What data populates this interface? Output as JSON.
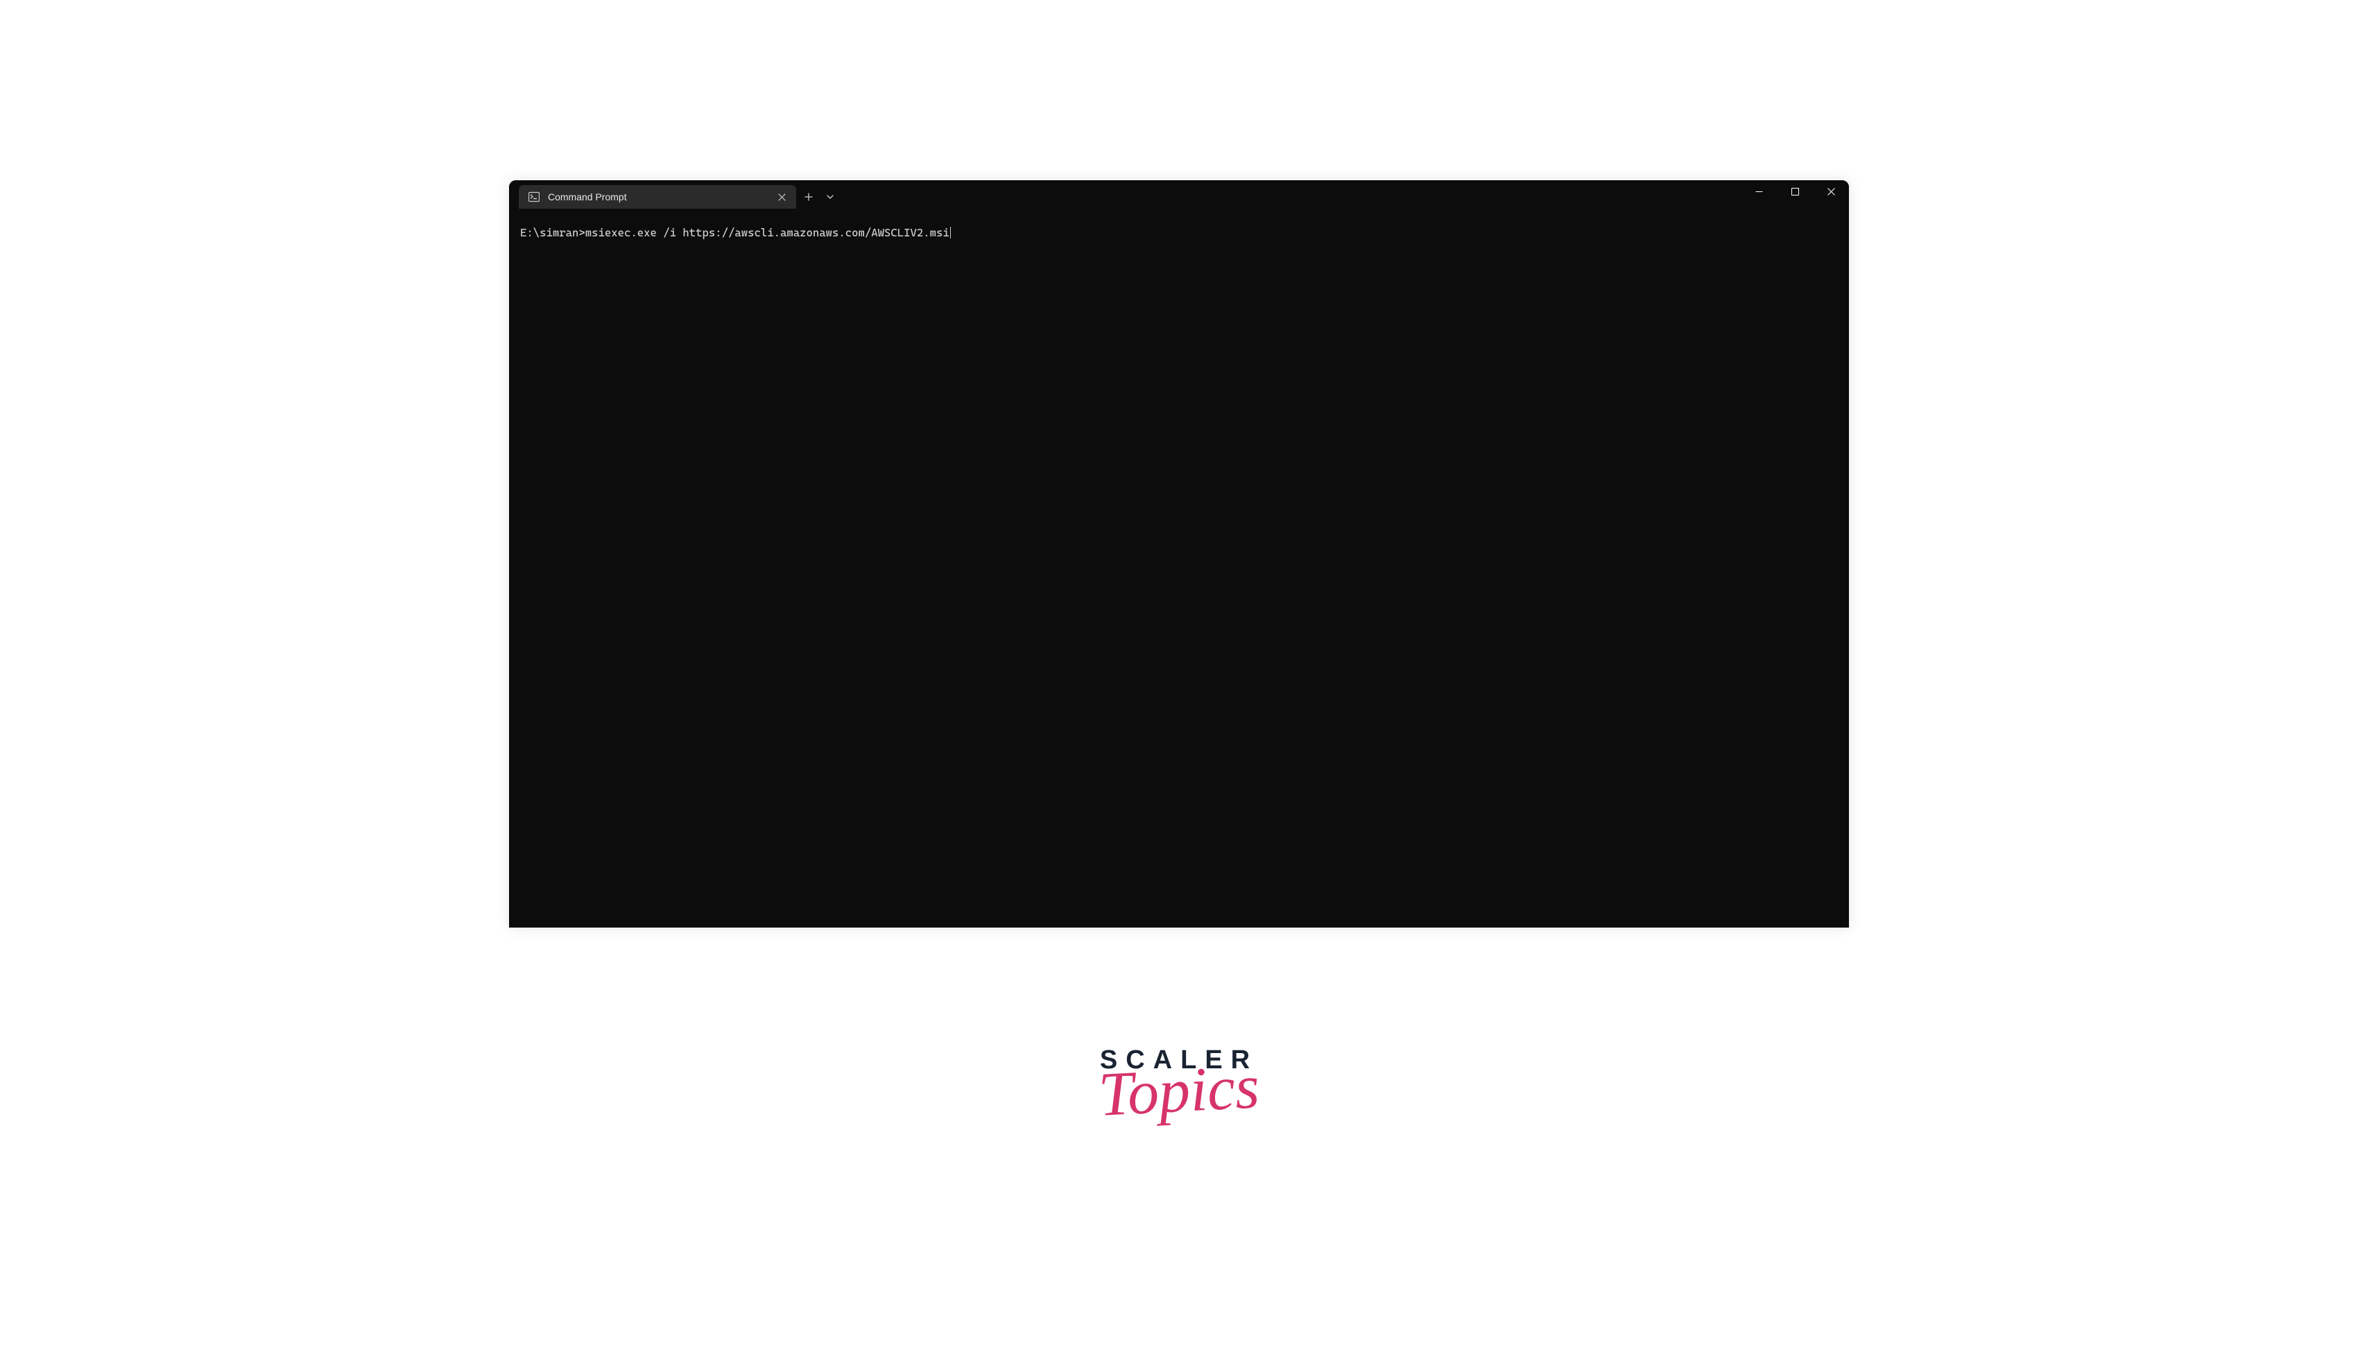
{
  "window": {
    "tab_title": "Command Prompt"
  },
  "terminal": {
    "prompt": "E:\\simran>",
    "command": "msiexec.exe /i https://awscli.amazonaws.com/AWSCLIV2.msi"
  },
  "logo": {
    "line1": "SCALER",
    "line2": "Topics"
  }
}
